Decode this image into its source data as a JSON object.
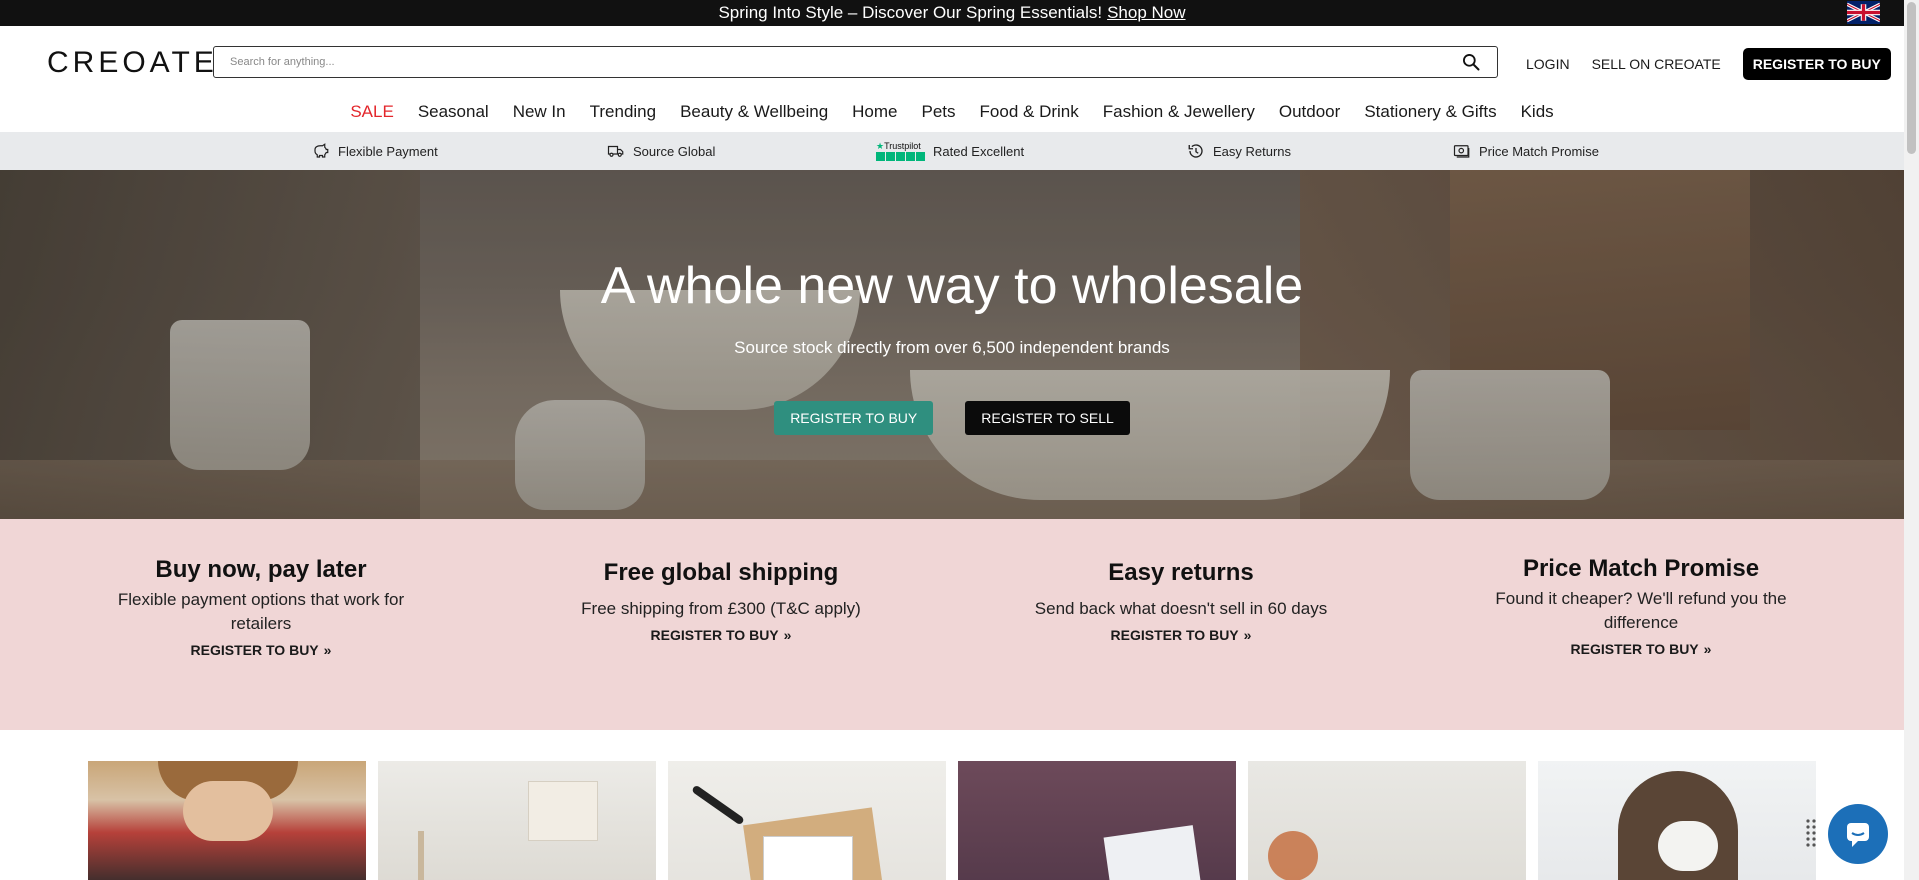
{
  "promo": {
    "text": "Spring Into Style – Discover Our Spring Essentials!",
    "link": "Shop Now"
  },
  "header": {
    "logo": "CREOATE",
    "search_placeholder": "Search for anything...",
    "login": "LOGIN",
    "sell": "SELL ON CREOATE",
    "register": "REGISTER TO BUY"
  },
  "categories": [
    "SALE",
    "Seasonal",
    "New In",
    "Trending",
    "Beauty & Wellbeing",
    "Home",
    "Pets",
    "Food & Drink",
    "Fashion & Jewellery",
    "Outdoor",
    "Stationery & Gifts",
    "Kids"
  ],
  "usp": {
    "flexible": "Flexible Payment",
    "source": "Source Global",
    "trustpilot": "Trustpilot",
    "rated": "Rated Excellent",
    "returns": "Easy Returns",
    "price": "Price Match Promise"
  },
  "hero": {
    "title": "A whole new way to wholesale",
    "subtitle": "Source stock directly from over 6,500 independent brands",
    "buy": "REGISTER TO BUY",
    "sell": "REGISTER TO SELL"
  },
  "benefits": [
    {
      "title": "Buy now, pay later",
      "desc": "Flexible payment options that work for retailers",
      "cta": "REGISTER TO BUY"
    },
    {
      "title": "Free global shipping",
      "desc": "Free shipping from £300 (T&C apply)",
      "cta": "REGISTER TO BUY"
    },
    {
      "title": "Easy returns",
      "desc": "Send back what doesn't sell in 60 days",
      "cta": "REGISTER TO BUY"
    },
    {
      "title": "Price Match Promise",
      "desc": "Found it cheaper? We'll refund you the difference",
      "cta": "REGISTER TO BUY"
    }
  ],
  "colors": {
    "sale": "#e3262b",
    "teal": "#2f8f7f",
    "benefits_bg": "#f0d6d6",
    "chat": "#1c6fb8"
  }
}
